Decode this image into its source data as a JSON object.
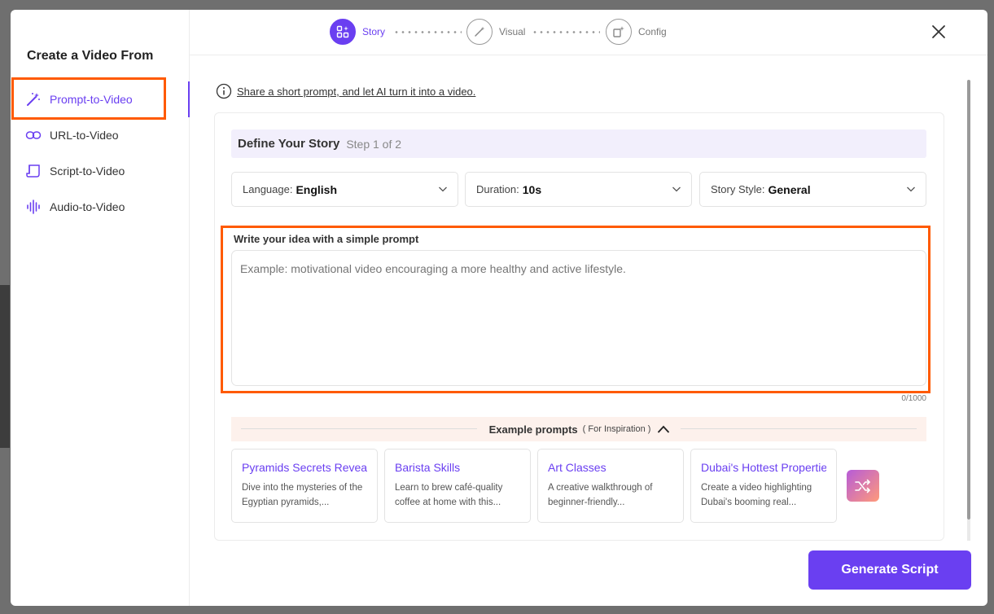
{
  "sidebar": {
    "title": "Create a Video From",
    "items": [
      {
        "label": "Prompt-to-Video"
      },
      {
        "label": "URL-to-Video"
      },
      {
        "label": "Script-to-Video"
      },
      {
        "label": "Audio-to-Video"
      }
    ]
  },
  "steps": [
    {
      "label": "Story"
    },
    {
      "label": "Visual"
    },
    {
      "label": "Config"
    }
  ],
  "info": {
    "text": "Share a short prompt, and let AI turn it into a video."
  },
  "define": {
    "title": "Define Your Story",
    "step": "Step 1 of 2"
  },
  "dropdowns": [
    {
      "label": "Language:",
      "value": "English"
    },
    {
      "label": "Duration:",
      "value": "10s"
    },
    {
      "label": "Story Style:",
      "value": "General"
    }
  ],
  "prompt": {
    "label": "Write your idea with a simple prompt",
    "placeholder": "Example: motivational video encouraging a more healthy and active lifestyle.",
    "counter": "0/1000"
  },
  "examples": {
    "title": "Example prompts",
    "subtitle": "( For Inspiration )",
    "cards": [
      {
        "title": "Pyramids Secrets Revealed",
        "desc": "Dive into the mysteries of the Egyptian pyramids,..."
      },
      {
        "title": "Barista Skills",
        "desc": "Learn to brew café-quality coffee at home with this..."
      },
      {
        "title": "Art Classes",
        "desc": "A creative walkthrough of beginner-friendly..."
      },
      {
        "title": "Dubai's Hottest Properties",
        "desc": "Create a video highlighting Dubai's booming real..."
      }
    ]
  },
  "generate_label": "Generate Script",
  "colors": {
    "accent": "#6a3ff1",
    "highlight": "#ff5a00"
  }
}
